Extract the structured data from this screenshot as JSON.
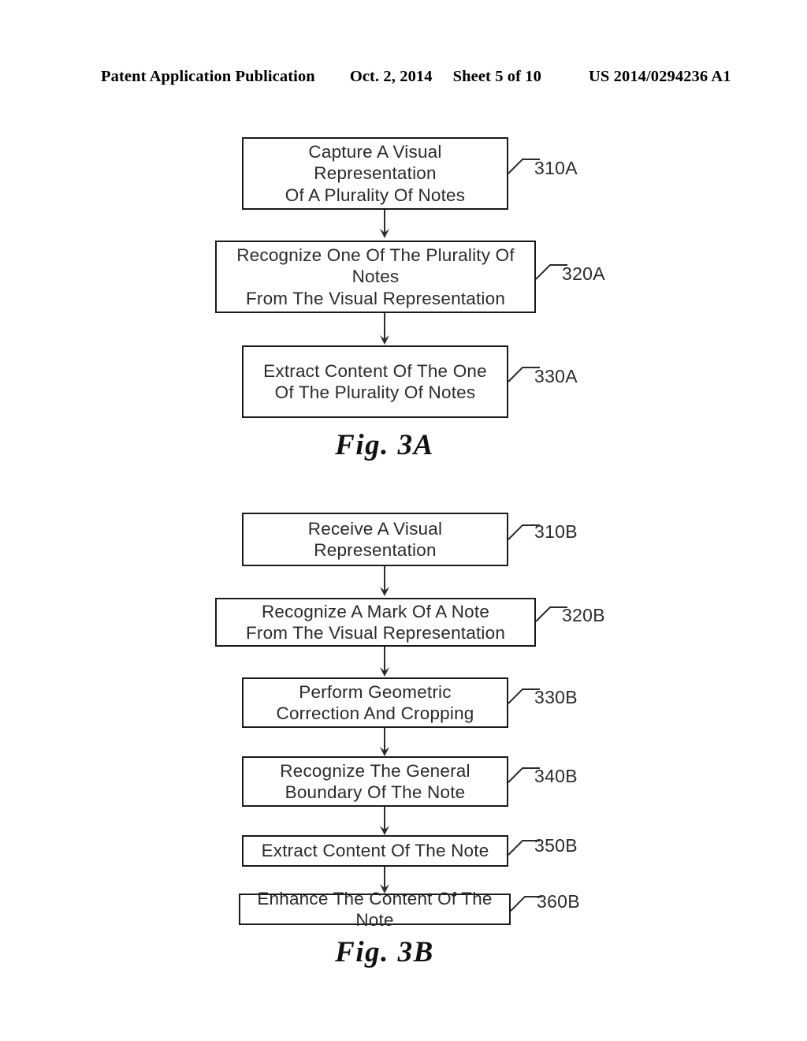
{
  "header": {
    "publication": "Patent Application Publication",
    "date": "Oct. 2, 2014",
    "sheet": "Sheet 5 of 10",
    "number": "US 2014/0294236 A1"
  },
  "figures": [
    {
      "caption": "Fig. 3A",
      "steps": [
        {
          "ref": "310A",
          "line1": "Capture A Visual Representation",
          "line2": "Of A Plurality Of Notes"
        },
        {
          "ref": "320A",
          "line1": "Recognize One Of The Plurality Of Notes",
          "line2": "From The Visual Representation"
        },
        {
          "ref": "330A",
          "line1": "Extract Content Of The One",
          "line2": "Of The Plurality Of Notes"
        }
      ]
    },
    {
      "caption": "Fig. 3B",
      "steps": [
        {
          "ref": "310B",
          "line1": "Receive A Visual",
          "line2": "Representation"
        },
        {
          "ref": "320B",
          "line1": "Recognize A Mark Of A Note",
          "line2": "From The Visual Representation"
        },
        {
          "ref": "330B",
          "line1": "Perform Geometric",
          "line2": "Correction And Cropping"
        },
        {
          "ref": "340B",
          "line1": "Recognize The General",
          "line2": "Boundary Of The Note"
        },
        {
          "ref": "350B",
          "line1": "Extract Content Of The Note",
          "line2": ""
        },
        {
          "ref": "360B",
          "line1": "Enhance The Content Of The Note",
          "line2": ""
        }
      ]
    }
  ],
  "colors": {
    "ink": "#2b2b2b",
    "border": "#1a1a1a",
    "background": "#ffffff"
  }
}
